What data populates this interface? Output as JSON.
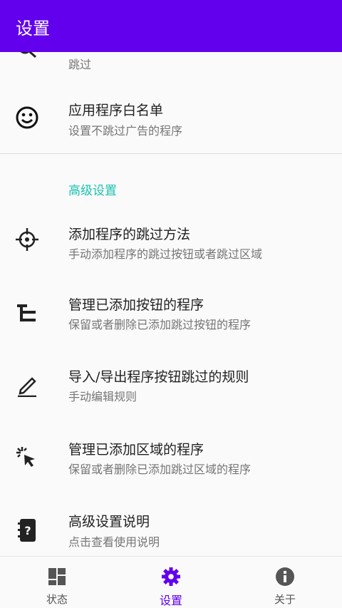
{
  "appbar": {
    "title": "设置"
  },
  "items": [
    {
      "title": "",
      "subtitle": "跳过",
      "icon": "magnify-icon"
    },
    {
      "title": "应用程序白名单",
      "subtitle": "设置不跳过广告的程序",
      "icon": "smiley-icon"
    },
    {
      "title": "添加程序的跳过方法",
      "subtitle": "手动添加程序的跳过按钮或者跳过区域",
      "icon": "crosshair-icon"
    },
    {
      "title": "管理已添加按钮的程序",
      "subtitle": "保留或者删除已添加跳过按钮的程序",
      "icon": "tree-list-icon"
    },
    {
      "title": "导入/导出程序按钮跳过的规则",
      "subtitle": "手动编辑规则",
      "icon": "pencil-icon"
    },
    {
      "title": "管理已添加区域的程序",
      "subtitle": "保留或者删除已添加跳过区域的程序",
      "icon": "click-cursor-icon"
    },
    {
      "title": "高级设置说明",
      "subtitle": "点击查看使用说明",
      "icon": "help-book-icon"
    }
  ],
  "section": {
    "advanced_label": "高级设置"
  },
  "bottom_nav": {
    "active": "settings",
    "items": [
      {
        "label": "状态",
        "icon": "dashboard-icon"
      },
      {
        "label": "设置",
        "icon": "gear-icon"
      },
      {
        "label": "关于",
        "icon": "info-icon"
      }
    ]
  },
  "colors": {
    "primary": "#6200ee",
    "accent": "#1bc3b0"
  }
}
